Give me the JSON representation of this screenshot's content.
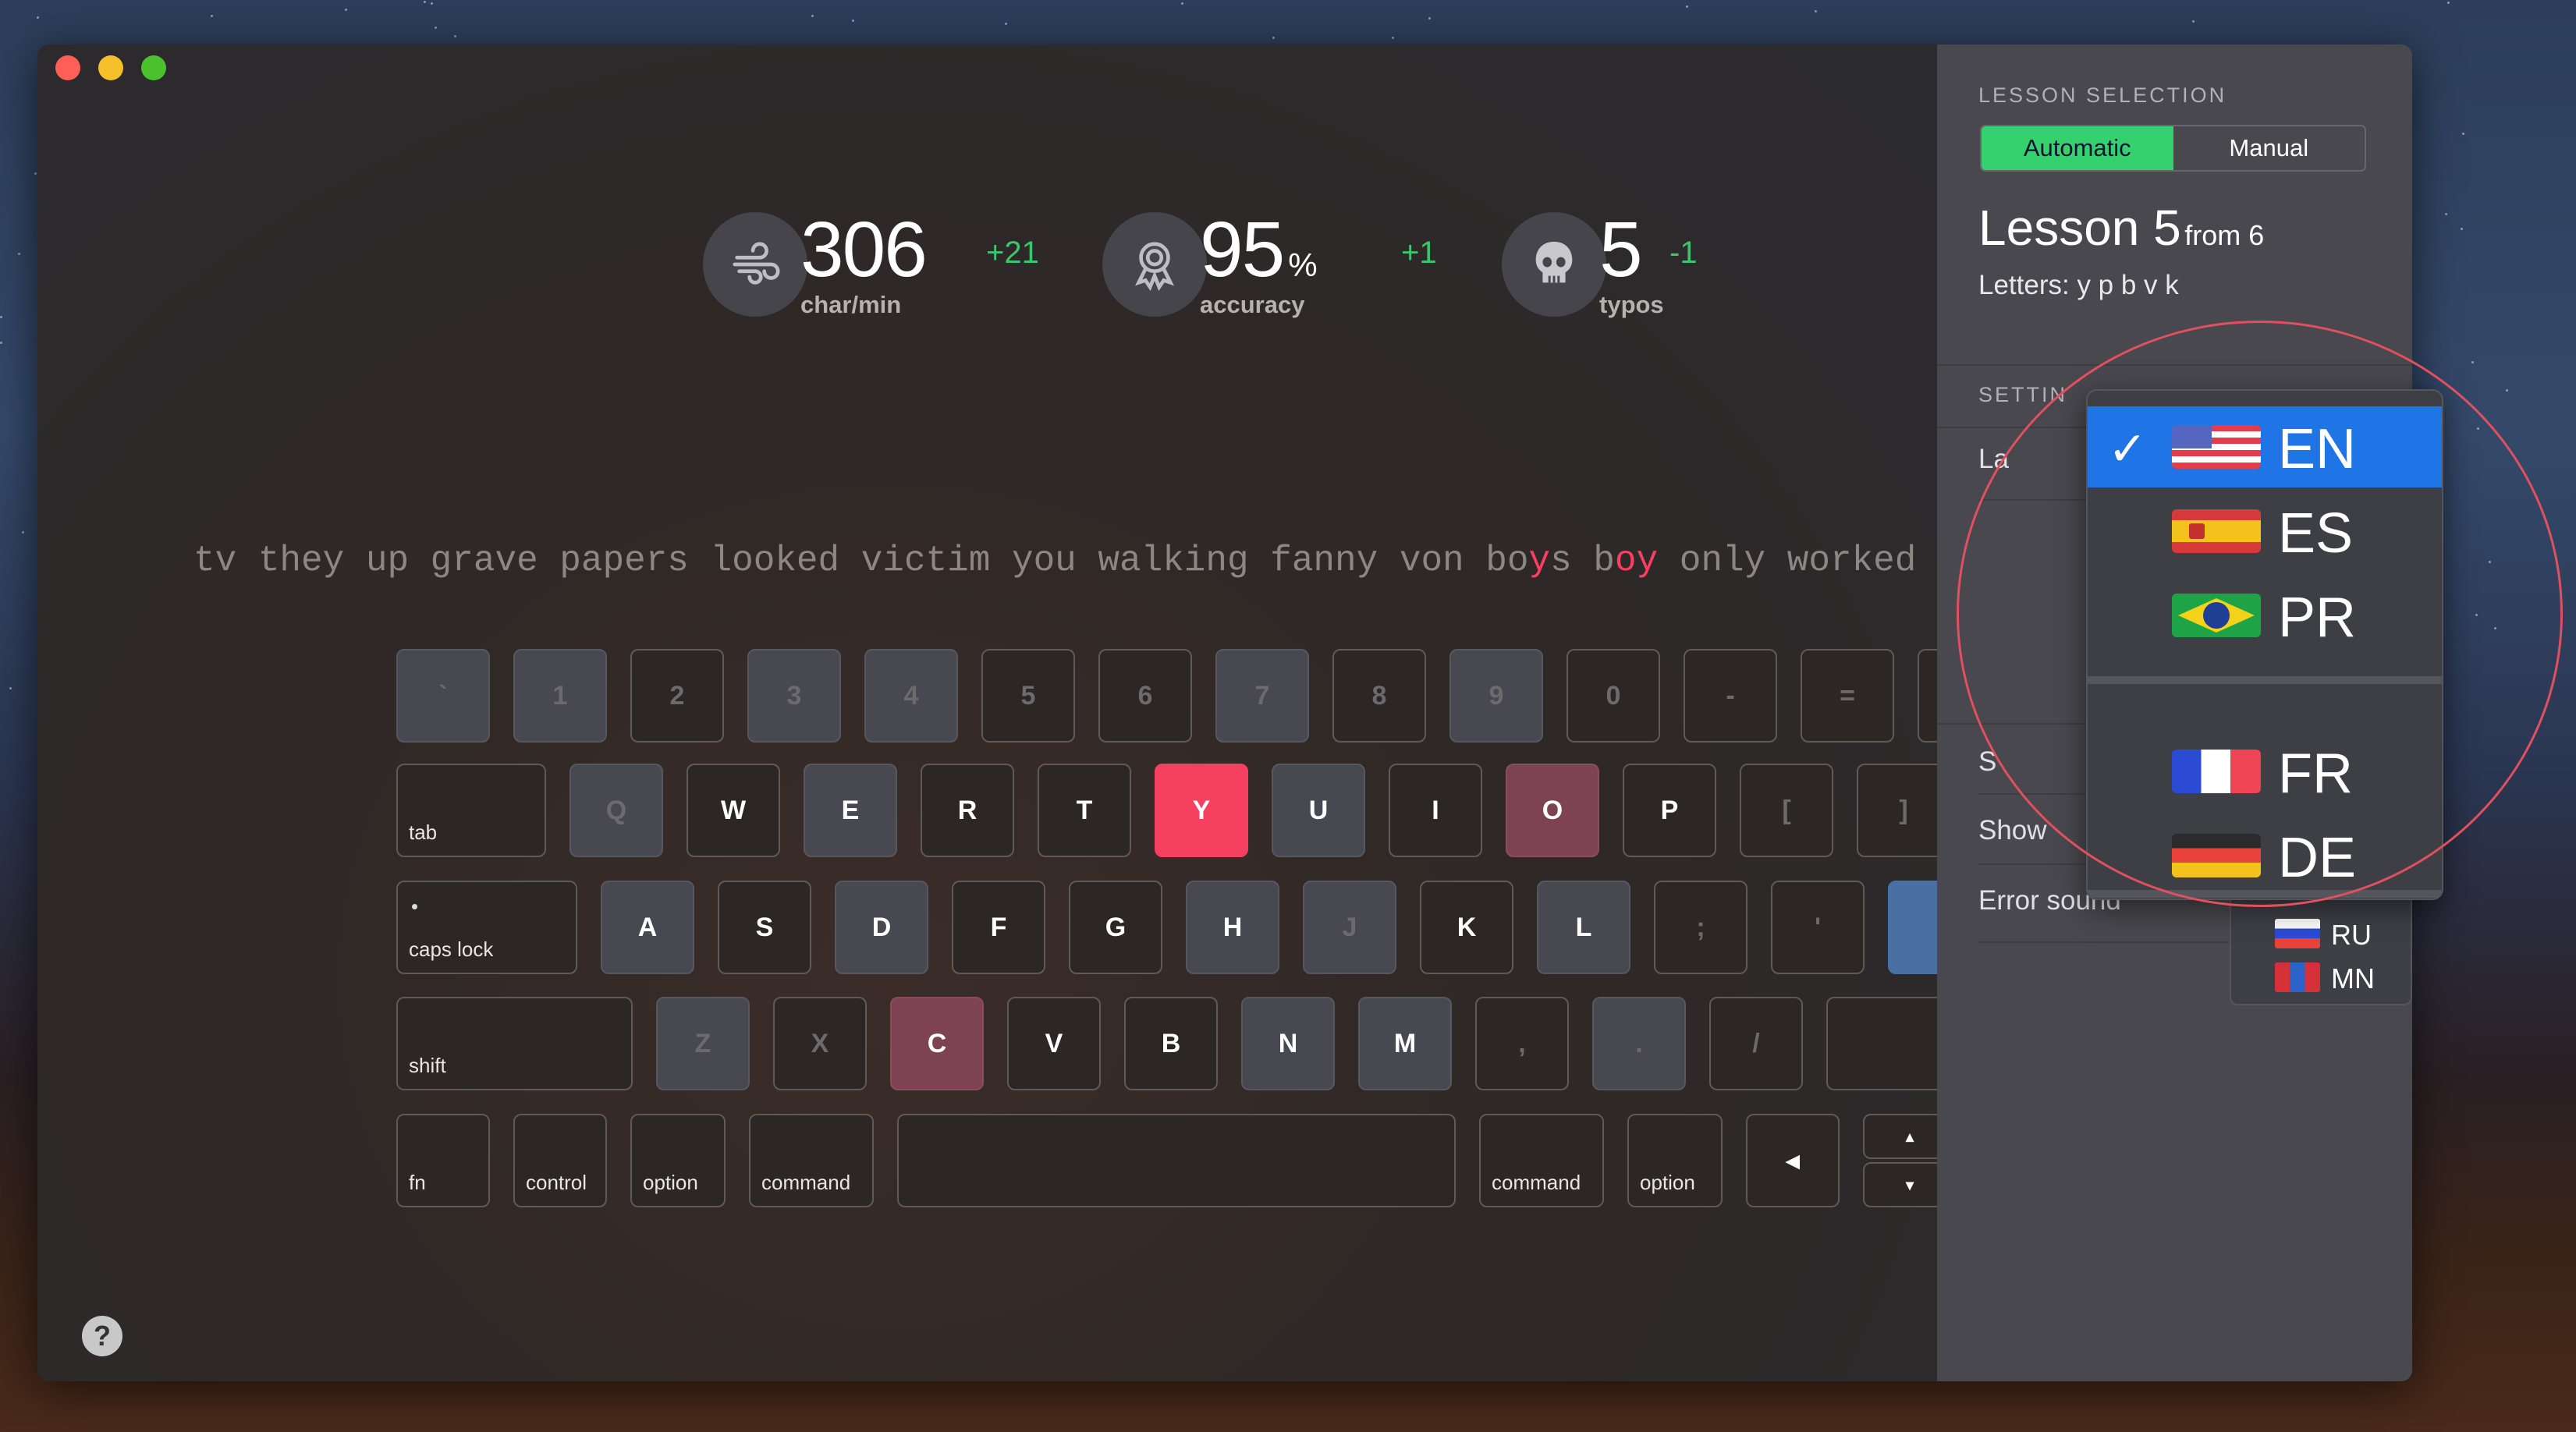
{
  "window": {
    "controls": [
      {
        "name": "close",
        "color": "#ff5f57"
      },
      {
        "name": "minimize",
        "color": "#f5c12a"
      },
      {
        "name": "zoom",
        "color": "#4cc12e"
      }
    ]
  },
  "stats": [
    {
      "icon": "wind-icon",
      "value": "306",
      "unit": "",
      "delta": "+21",
      "label": "char/min"
    },
    {
      "icon": "award-ribbon-icon",
      "value": "95",
      "unit": "%",
      "delta": "+1",
      "label": "accuracy"
    },
    {
      "icon": "skull-icon",
      "value": "5",
      "unit": "",
      "delta": "-1",
      "label": "typos"
    }
  ],
  "practice_text": [
    {
      "t": "tv they up grave papers looked victim you walking fanny von bo",
      "err": false
    },
    {
      "t": "y",
      "err": true
    },
    {
      "t": "s b",
      "err": false
    },
    {
      "t": "oy",
      "err": true
    },
    {
      "t": " only worked my",
      "err": false
    }
  ],
  "keyboard": {
    "rows": [
      [
        [
          "`",
          "gray faded"
        ],
        [
          "1",
          "gray faded"
        ],
        [
          "2",
          "faded"
        ],
        [
          "3",
          "gray faded"
        ],
        [
          "4",
          "gray faded"
        ],
        [
          "5",
          "faded"
        ],
        [
          "6",
          "faded"
        ],
        [
          "7",
          "gray faded"
        ],
        [
          "8",
          "faded"
        ],
        [
          "9",
          "gray faded"
        ],
        [
          "0",
          "faded"
        ],
        [
          "-",
          "faded"
        ],
        [
          "=",
          "faded"
        ],
        [
          "",
          "faded"
        ]
      ],
      [
        [
          "tab",
          "mod"
        ],
        [
          "Q",
          "gray faded"
        ],
        [
          "W",
          ""
        ],
        [
          "E",
          "gray"
        ],
        [
          "R",
          ""
        ],
        [
          "T",
          ""
        ],
        [
          "Y",
          "red"
        ],
        [
          "U",
          "gray"
        ],
        [
          "I",
          ""
        ],
        [
          "O",
          "rose"
        ],
        [
          "P",
          ""
        ],
        [
          "[",
          "faded"
        ],
        [
          "]",
          "faded"
        ]
      ],
      [
        [
          "caps lock",
          "mod"
        ],
        [
          "A",
          "gray"
        ],
        [
          "S",
          ""
        ],
        [
          "D",
          "gray"
        ],
        [
          "F",
          ""
        ],
        [
          "G",
          ""
        ],
        [
          "H",
          "gray"
        ],
        [
          "J",
          "gray faded"
        ],
        [
          "K",
          ""
        ],
        [
          "L",
          "gray"
        ],
        [
          ";",
          "faded"
        ],
        [
          "'",
          "faded"
        ],
        [
          "",
          "blue"
        ]
      ],
      [
        [
          "shift",
          "mod"
        ],
        [
          "Z",
          "gray faded"
        ],
        [
          "X",
          "faded"
        ],
        [
          "C",
          "rose"
        ],
        [
          "V",
          ""
        ],
        [
          "B",
          ""
        ],
        [
          "N",
          "gray"
        ],
        [
          "M",
          "gray"
        ],
        [
          ",",
          "faded"
        ],
        [
          ".",
          "gray faded"
        ],
        [
          "/",
          "faded"
        ],
        [
          "",
          "faded"
        ]
      ],
      [
        [
          "fn",
          "mod"
        ],
        [
          "control",
          "mod"
        ],
        [
          "option",
          "mod"
        ],
        [
          "command",
          "mod"
        ],
        [
          "",
          "space"
        ],
        [
          "command",
          "mod"
        ],
        [
          "option",
          "mod"
        ],
        [
          "◂",
          ""
        ],
        [
          "▴/▾",
          "arrows"
        ]
      ]
    ]
  },
  "help_label": "?",
  "sidebar": {
    "lesson_section": "LESSON SELECTION",
    "modes": [
      "Automatic",
      "Manual"
    ],
    "selected_mode": "Automatic",
    "lesson_title": "Lesson 5",
    "lesson_of": "from 6",
    "letters": "Letters: y p b v k",
    "settings_section": "SETTIN",
    "rows": [
      "La",
      "S",
      "Show",
      "Error sound"
    ]
  },
  "language_menu": {
    "selected": "EN",
    "items": [
      {
        "code": "EN",
        "flag": "us"
      },
      {
        "code": "ES",
        "flag": "es"
      },
      {
        "code": "PR",
        "flag": "br"
      },
      {
        "code": "FR",
        "flag": "fr"
      },
      {
        "code": "DE",
        "flag": "de"
      }
    ],
    "more": [
      {
        "code": "RU",
        "flag": "ru"
      },
      {
        "code": "MN",
        "flag": "mn"
      }
    ],
    "highlight_color": "#1f74e6"
  },
  "colors": {
    "accent_green": "#35d16f",
    "error_red": "#f5405f",
    "delta_green": "#3ec46d"
  }
}
